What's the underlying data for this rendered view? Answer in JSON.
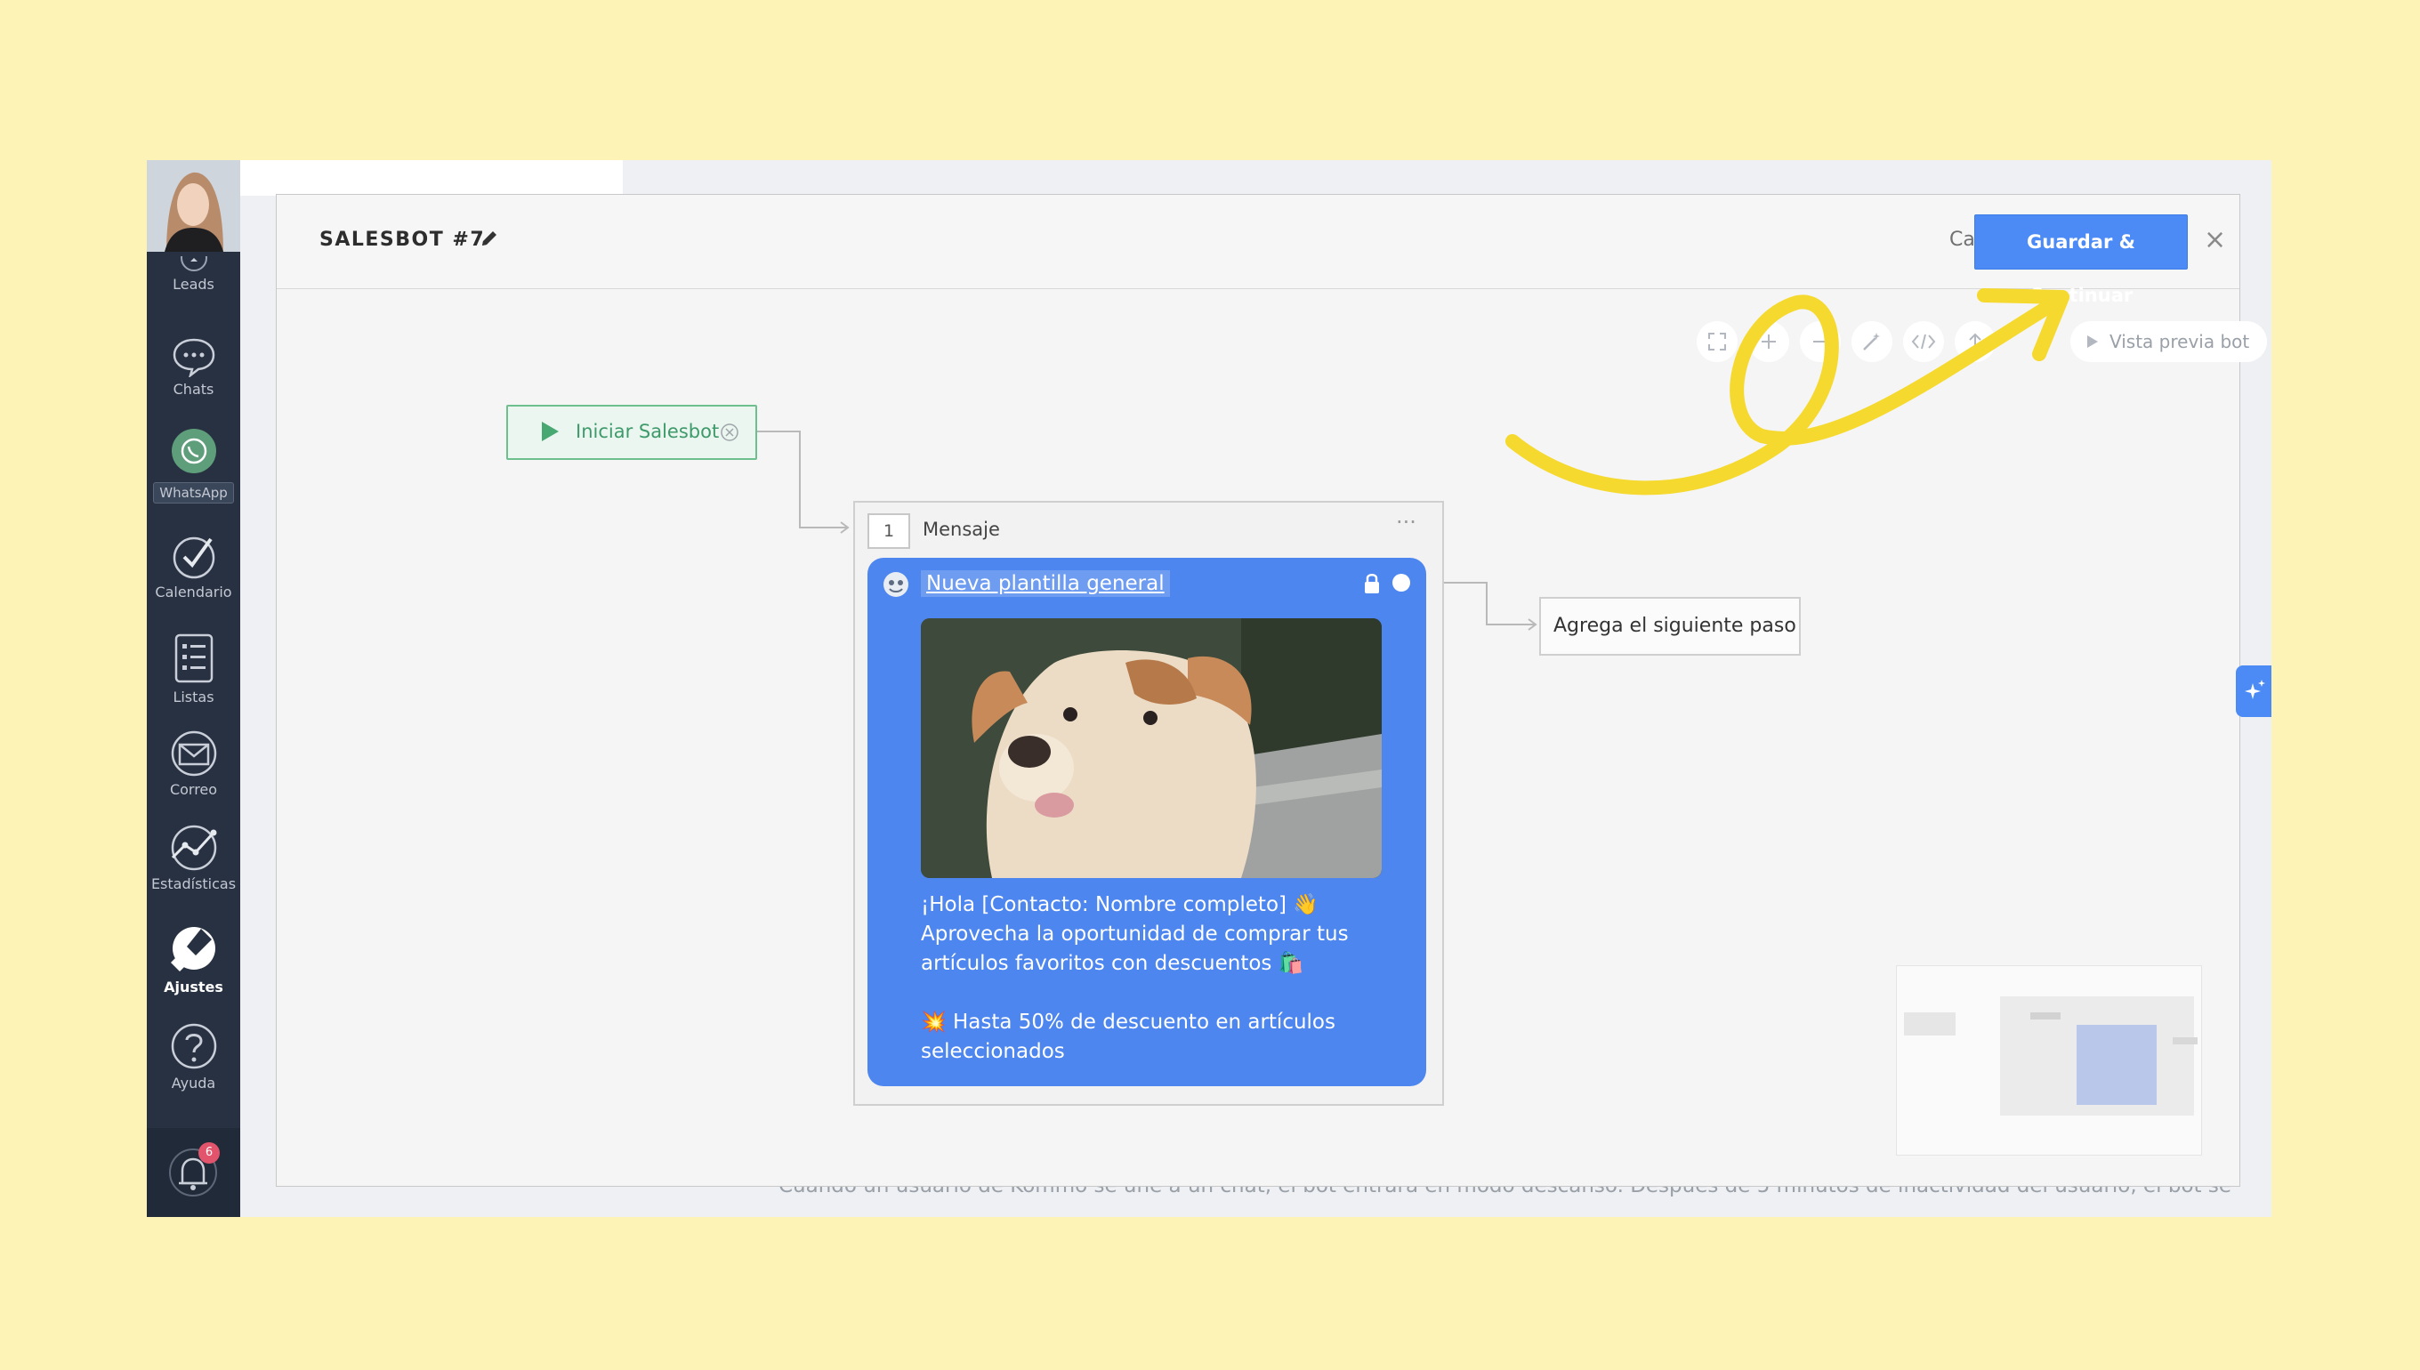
{
  "sidebar": {
    "items": [
      {
        "label": "Leads",
        "icon": "leads-icon"
      },
      {
        "label": "Chats",
        "icon": "chat-bubble-icon"
      },
      {
        "label": "WhatsApp",
        "icon": "whatsapp-icon"
      },
      {
        "label": "Calendario",
        "icon": "checkmark-circle-icon"
      },
      {
        "label": "Listas",
        "icon": "list-icon"
      },
      {
        "label": "Correo",
        "icon": "envelope-icon"
      },
      {
        "label": "Estadísticas",
        "icon": "stats-chart-icon"
      },
      {
        "label": "Ajustes",
        "icon": "wrench-icon"
      },
      {
        "label": "Ayuda",
        "icon": "question-icon"
      }
    ],
    "notifications_count": "6"
  },
  "header": {
    "title": "SALESBOT #7",
    "cancel_label": "Cancelar",
    "save_label": "Guardar & Continuar",
    "close_label": "×"
  },
  "toolbar": {
    "preview_label": "Vista previa bot"
  },
  "nodes": {
    "start_label": "Iniciar Salesbot",
    "message_step_number": "1",
    "message_title": "Mensaje",
    "template_name": "Nueva plantilla general",
    "message_lines": [
      "¡Hola [Contacto: Nombre completo] 👋",
      "Aprovecha la oportunidad de comprar tus",
      "artículos favoritos con descuentos 🛍️",
      "",
      "💥 Hasta 50% de descuento en artículos",
      "seleccionados"
    ],
    "next_step_label": "Agrega el siguiente paso"
  },
  "background": {
    "partial_text": "Cuando un usuario de Kommo se une a un chat, el bot entrará en modo descanso. Después de   5 minutos   de inactividad del usuario, el bot se"
  },
  "colors": {
    "page_background": "#fef3b6",
    "sidebar": "#273142",
    "accent_blue": "#4c8bf5",
    "start_green": "#6ebf8e",
    "annotation_yellow": "#f5d92e",
    "badge_red": "#e2546b"
  }
}
